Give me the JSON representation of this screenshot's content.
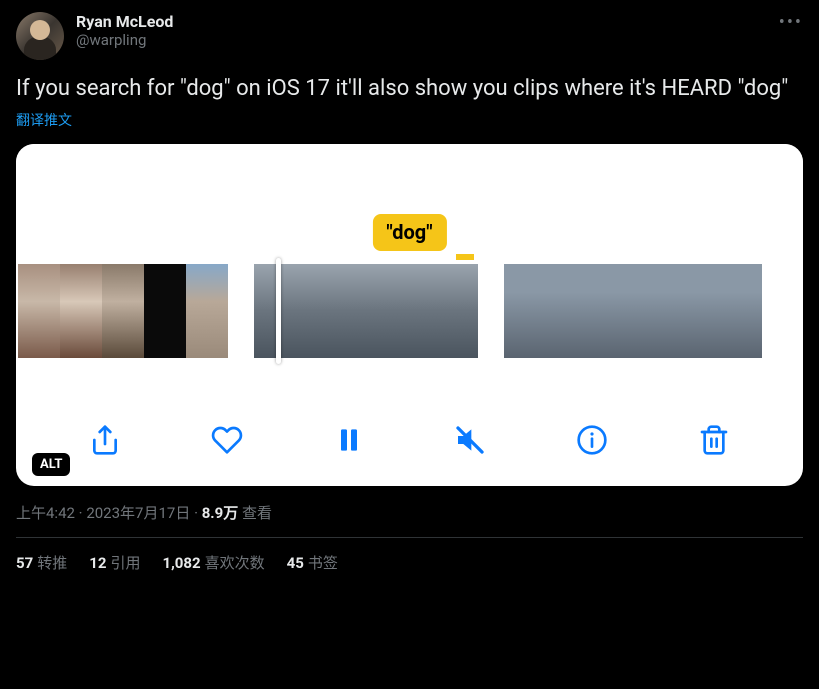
{
  "author": {
    "display_name": "Ryan McLeod",
    "handle": "@warpling"
  },
  "body_text": "If you search for \"dog\" on iOS 17 it'll also show you clips where it's HEARD \"dog\"",
  "translate_label": "翻译推文",
  "media": {
    "caption_badge": "\"dog\"",
    "alt_label": "ALT"
  },
  "meta": {
    "time": "上午4:42",
    "date": "2023年7月17日",
    "views_count": "8.9万",
    "views_label": "查看"
  },
  "stats": {
    "retweets_count": "57",
    "retweets_label": "转推",
    "quotes_count": "12",
    "quotes_label": "引用",
    "likes_count": "1,082",
    "likes_label": "喜欢次数",
    "bookmarks_count": "45",
    "bookmarks_label": "书签"
  }
}
